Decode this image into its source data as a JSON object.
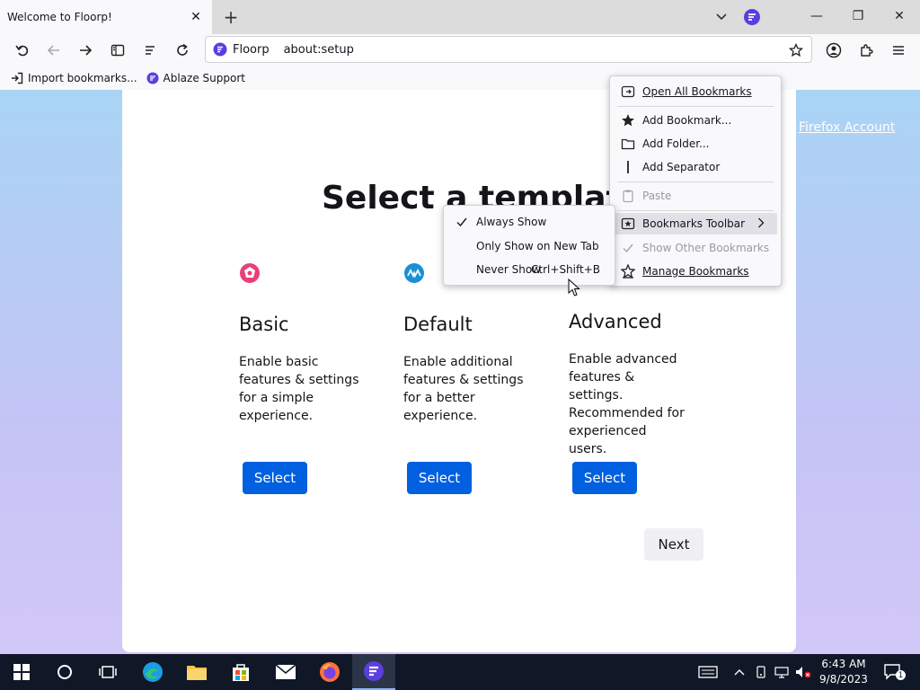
{
  "window": {
    "tab_title": "Welcome to Floorp!",
    "controls": {
      "minimize": "—",
      "maximize": "❐",
      "close": "✕"
    }
  },
  "navbar": {
    "identity_label": "Floorp",
    "url": "about:setup"
  },
  "bookmarks_bar": {
    "items": [
      {
        "label": "Import bookmarks...",
        "icon": "import-icon"
      },
      {
        "label": "Ablaze Support",
        "icon": "ablaze-icon"
      }
    ]
  },
  "page": {
    "account_link": "Firefox Account",
    "heading": "Select a template",
    "templates": [
      {
        "title": "Basic",
        "description": "Enable basic features & settings for a simple experience.",
        "button": "Select",
        "icon_color": "#e8407a"
      },
      {
        "title": "Default",
        "description": "Enable additional features & settings for a better experience.",
        "button": "Select",
        "icon_color": "#1a8fd6"
      },
      {
        "title": "Advanced",
        "description": "Enable advanced features & settings. Recommended for experienced users.",
        "button": "Select",
        "icon_color": "#000000"
      }
    ],
    "next_button": "Next"
  },
  "bookmarks_menu": {
    "items": [
      {
        "label": "Open All Bookmarks",
        "icon": "open-all-icon",
        "disabled": false
      },
      {
        "label": "Add Bookmark...",
        "icon": "star-icon",
        "disabled": false
      },
      {
        "label": "Add Folder...",
        "icon": "folder-icon",
        "disabled": false
      },
      {
        "label": "Add Separator",
        "icon": "separator-icon",
        "disabled": false
      },
      {
        "label": "Paste",
        "icon": "paste-icon",
        "disabled": true
      },
      {
        "label": "Bookmarks Toolbar",
        "icon": "bookmarks-toolbar-icon",
        "disabled": false
      },
      {
        "label": "Show Other Bookmarks",
        "icon": "check-icon",
        "disabled": true
      },
      {
        "label": "Manage Bookmarks",
        "icon": "manage-icon",
        "disabled": false
      }
    ]
  },
  "toolbar_submenu": {
    "items": [
      {
        "label": "Always Show",
        "checked": true,
        "accel": ""
      },
      {
        "label": "Only Show on New Tab",
        "checked": false,
        "accel": ""
      },
      {
        "label": "Never Show",
        "checked": false,
        "accel": "Ctrl+Shift+B"
      }
    ]
  },
  "taskbar": {
    "time": "6:43 AM",
    "date": "9/8/2023",
    "notification_count": "1"
  },
  "colors": {
    "accent": "#0060df",
    "floorp_purple": "#5b3ee0"
  }
}
